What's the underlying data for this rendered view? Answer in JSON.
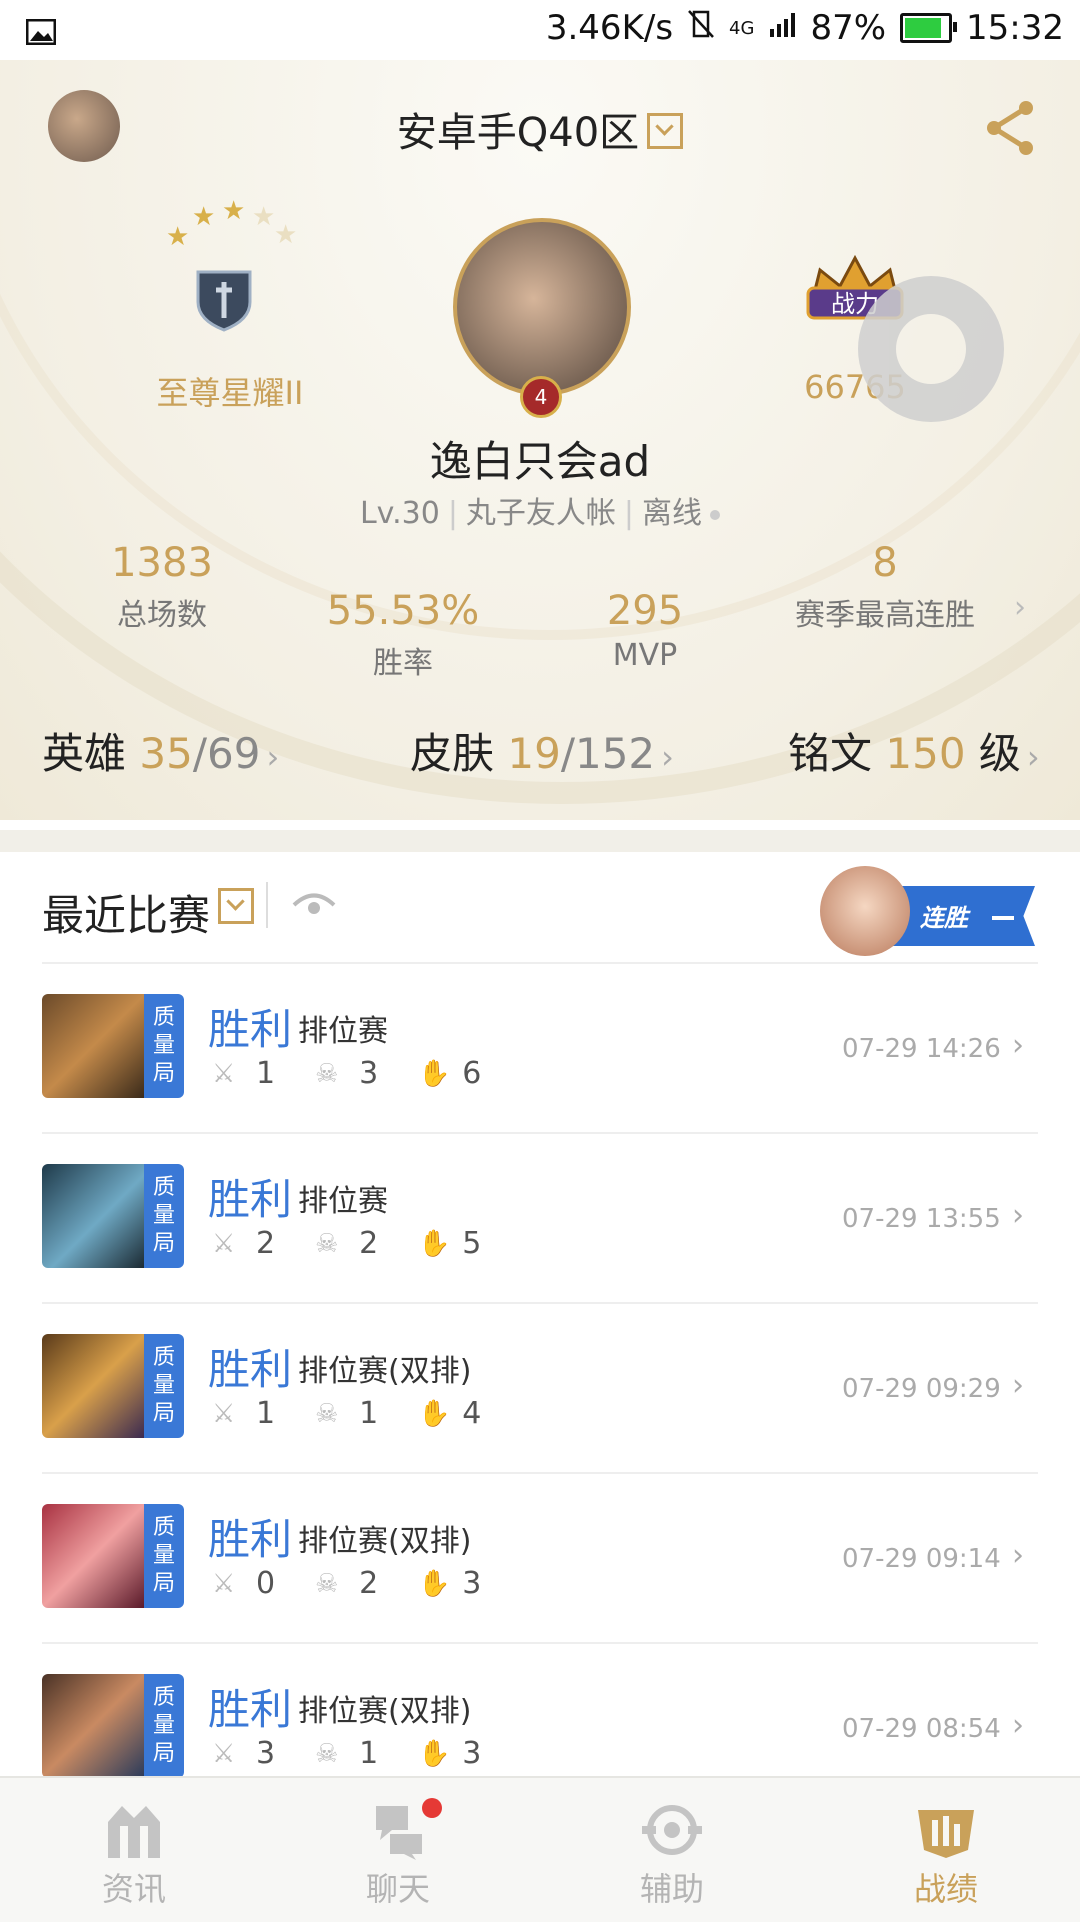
{
  "status_bar": {
    "speed": "3.46K/s",
    "network": "4G",
    "battery": "87%",
    "time": "15:32",
    "battery_level": 0.87
  },
  "header": {
    "server": "安卓手Q40区"
  },
  "profile": {
    "rank_name": "至尊星耀II",
    "rank_stars_filled": 3,
    "rank_stars_total": 5,
    "level_badge": "4",
    "power_label": "战力",
    "power_value": "66765",
    "nickname": "逸白只会ad",
    "level": "Lv.30",
    "account_type": "丸子友人帐",
    "online_status": "离线"
  },
  "stats": {
    "total_games_value": "1383",
    "total_games_label": "总场数",
    "win_rate_value": "55.53%",
    "win_rate_label": "胜率",
    "mvp_value": "295",
    "mvp_label": "MVP",
    "streak_value": "8",
    "streak_label": "赛季最高连胜"
  },
  "counts": {
    "heroes_label": "英雄",
    "heroes_owned": "35",
    "heroes_total": "69",
    "skins_label": "皮肤",
    "skins_owned": "19",
    "skins_total": "152",
    "runes_label": "铭文",
    "runes_level": "150",
    "runes_unit": "级"
  },
  "recent": {
    "title": "最近比赛",
    "streak_badge": "连胜"
  },
  "matches": [
    {
      "result": "胜利",
      "mode": "排位赛",
      "tag": [
        "质",
        "量",
        "局"
      ],
      "kills": "1",
      "deaths": "3",
      "assists": "6",
      "time": "07-29 14:26"
    },
    {
      "result": "胜利",
      "mode": "排位赛",
      "tag": [
        "质",
        "量",
        "局"
      ],
      "kills": "2",
      "deaths": "2",
      "assists": "5",
      "time": "07-29 13:55"
    },
    {
      "result": "胜利",
      "mode": "排位赛(双排)",
      "tag": [
        "质",
        "量",
        "局"
      ],
      "kills": "1",
      "deaths": "1",
      "assists": "4",
      "time": "07-29 09:29"
    },
    {
      "result": "胜利",
      "mode": "排位赛(双排)",
      "tag": [
        "质",
        "量",
        "局"
      ],
      "kills": "0",
      "deaths": "2",
      "assists": "3",
      "time": "07-29 09:14"
    },
    {
      "result": "胜利",
      "mode": "排位赛(双排)",
      "tag": [
        "质",
        "量",
        "局"
      ],
      "kills": "3",
      "deaths": "1",
      "assists": "3",
      "time": "07-29 08:54"
    }
  ],
  "tabs": [
    {
      "label": "资讯",
      "icon": "news-icon"
    },
    {
      "label": "聊天",
      "icon": "chat-icon"
    },
    {
      "label": "辅助",
      "icon": "assist-icon"
    },
    {
      "label": "战绩",
      "icon": "record-icon"
    }
  ],
  "colors": {
    "gold": "#c9a15a",
    "blue": "#3a78d6",
    "badge_red": "#e53935"
  }
}
